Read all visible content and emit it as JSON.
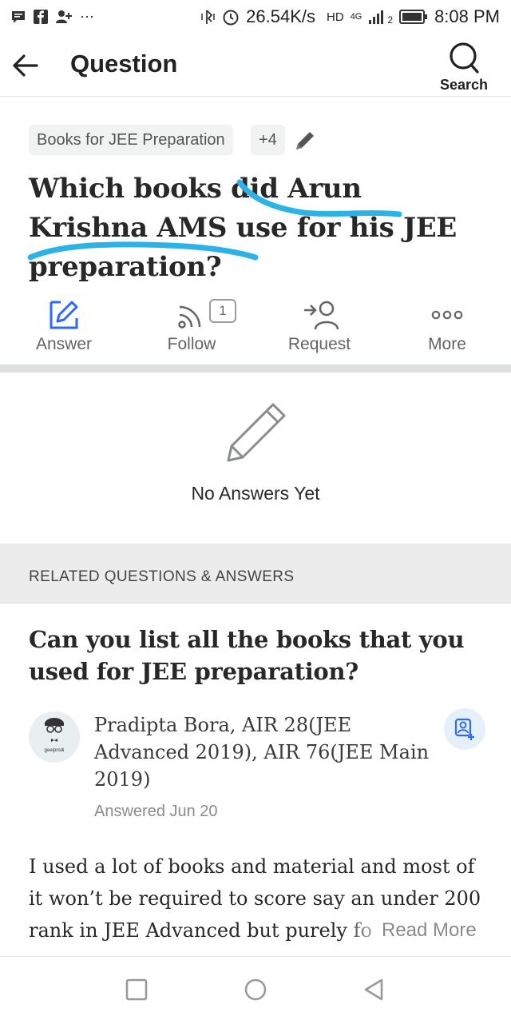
{
  "status_bar": {
    "speed": "26.54K/s",
    "hd": "HD",
    "network": "4G",
    "sim": "2",
    "time": "8:08 PM",
    "more": "···"
  },
  "header": {
    "title": "Question",
    "search_label": "Search"
  },
  "topics": {
    "primary": "Books for JEE Preparation",
    "more_count": "+4"
  },
  "question": {
    "title": "Which books did Arun Krishna AMS use for his JEE preparation?"
  },
  "actions": [
    {
      "label": "Answer",
      "icon": "answer-edit-icon"
    },
    {
      "label": "Follow",
      "icon": "follow-rss-icon",
      "count": "1"
    },
    {
      "label": "Request",
      "icon": "request-user-icon"
    },
    {
      "label": "More",
      "icon": "more-dots-icon"
    }
  ],
  "empty_state": {
    "text": "No Answers Yet",
    "icon": "pencil-icon"
  },
  "related": {
    "header": "RELATED QUESTIONS & ANSWERS",
    "question_title": "Can you list all the books that you used for JEE preparation?",
    "author": "Pradipta Bora, AIR 28(JEE Advanced 2019), AIR 76(JEE Main 2019)",
    "answered": "Answered Jun 20",
    "answer_excerpt": "I used a lot of books and material and most of it won’t be required to score say an under 200 rank in JEE Advanced but purely fo",
    "read_more": "Read More",
    "avatar_text": "geeiprodi"
  },
  "colors": {
    "accent_blue": "#2e69ff",
    "scribble": "#2bb3e8",
    "text_dark": "#282829",
    "text_gray": "#636466"
  },
  "nav_icons": [
    "recent-apps-icon",
    "home-icon",
    "back-nav-icon"
  ]
}
